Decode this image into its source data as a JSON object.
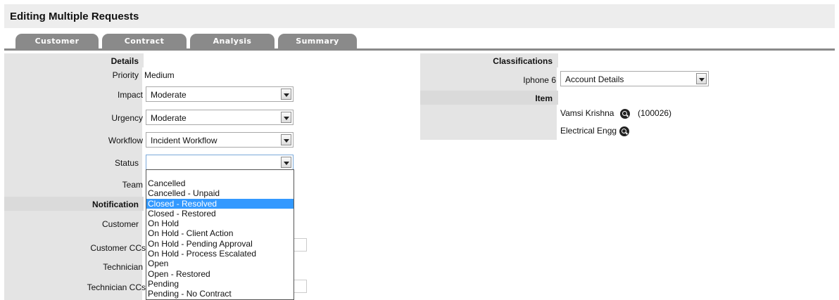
{
  "page": {
    "title": "Editing Multiple Requests"
  },
  "tabs": [
    "Customer",
    "Contract",
    "Analysis",
    "Summary"
  ],
  "details": {
    "header": "Details",
    "priority": {
      "label": "Priority",
      "value": "Medium"
    },
    "impact": {
      "label": "Impact",
      "value": "Moderate"
    },
    "urgency": {
      "label": "Urgency",
      "value": "Moderate"
    },
    "workflow": {
      "label": "Workflow",
      "value": "Incident Workflow"
    },
    "status": {
      "label": "Status",
      "value": "",
      "options": [
        "Cancelled",
        "Cancelled - Unpaid",
        "Closed - Resolved",
        "Closed - Restored",
        "On Hold",
        "On Hold - Client Action",
        "On Hold - Pending Approval",
        "On Hold - Process Escalated",
        "Open",
        "Open - Restored",
        "Pending",
        "Pending - No Contract"
      ],
      "highlighted": "Closed - Resolved"
    },
    "team": {
      "label": "Team"
    }
  },
  "notification": {
    "header": "Notification",
    "customer": "Customer",
    "customer_ccs": "Customer CCs",
    "technician": "Technician",
    "technician_ccs": "Technician CCs"
  },
  "classifications": {
    "header": "Classifications",
    "label": "Iphone 6",
    "value": "Account Details"
  },
  "item": {
    "header": "Item",
    "owner": "Vamsi Krishna",
    "owner_id": "(100026)",
    "department": "Electrical Engg"
  }
}
